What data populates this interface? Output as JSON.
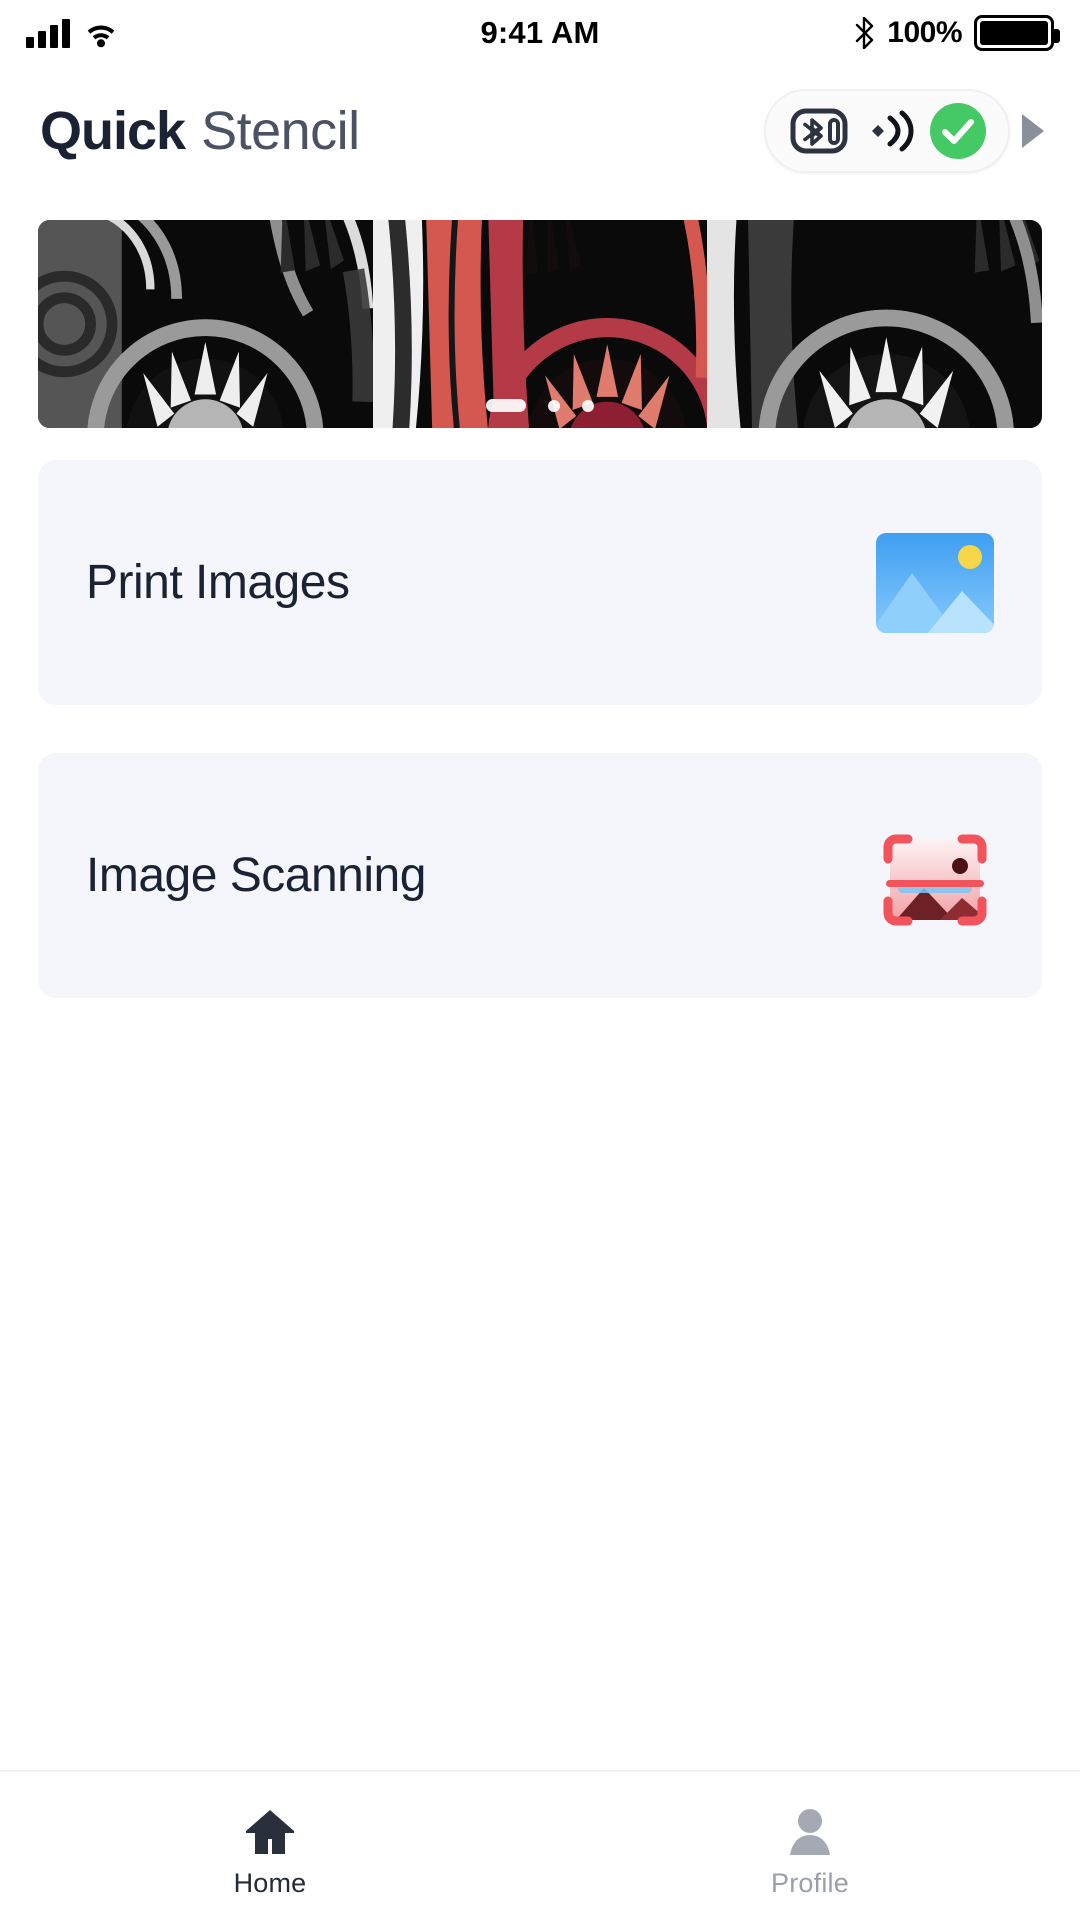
{
  "status_bar": {
    "time": "9:41 AM",
    "battery_percent": "100%",
    "cellular_icon": "cellular-bars-icon",
    "wifi_icon": "wifi-icon",
    "bluetooth_icon": "bluetooth-icon",
    "battery_icon": "battery-full-icon"
  },
  "header": {
    "brand_bold": "Quick",
    "brand_light": "Stencil",
    "connection": {
      "device_icon": "bluetooth-device-icon",
      "signal_icon": "signal-waves-icon",
      "status_icon": "check-circle-icon",
      "expand_icon": "play-arrow-icon",
      "status_color": "#45c964"
    }
  },
  "carousel": {
    "slides": [
      {
        "name": "mandala-gray",
        "palette": [
          "#000000",
          "#6e6e6e",
          "#a8a8a8",
          "#e8e8e8",
          "#3a3a3a"
        ]
      },
      {
        "name": "mandala-red",
        "palette": [
          "#000000",
          "#d4584f",
          "#8e1f32",
          "#b33a46",
          "#e07c6e"
        ]
      },
      {
        "name": "mandala-gray-2",
        "palette": [
          "#000000",
          "#6e6e6e",
          "#a8a8a8",
          "#e8e8e8",
          "#3a3a3a"
        ]
      }
    ],
    "active_index": 0,
    "dot_count": 3
  },
  "cards": [
    {
      "label": "Print Images",
      "icon": "picture-icon",
      "icon_colors": {
        "sky_top": "#49a7f5",
        "sky_bottom": "#7ec6fb",
        "sun": "#f7d64a",
        "mountain_back": "#8ed0fb",
        "mountain_front": "#b9e2fd"
      }
    },
    {
      "label": "Image Scanning",
      "icon": "scan-image-icon",
      "icon_colors": {
        "bracket": "#f2545b",
        "photo_top": "#fdf0f1",
        "photo_bottom": "#f3a0a4",
        "mountain": "#6e2027",
        "dot": "#4d1216",
        "scanline": "#7cc4f5"
      }
    }
  ],
  "tabbar": {
    "items": [
      {
        "label": "Home",
        "icon": "home-icon",
        "active": true
      },
      {
        "label": "Profile",
        "icon": "person-icon",
        "active": false
      }
    ]
  }
}
